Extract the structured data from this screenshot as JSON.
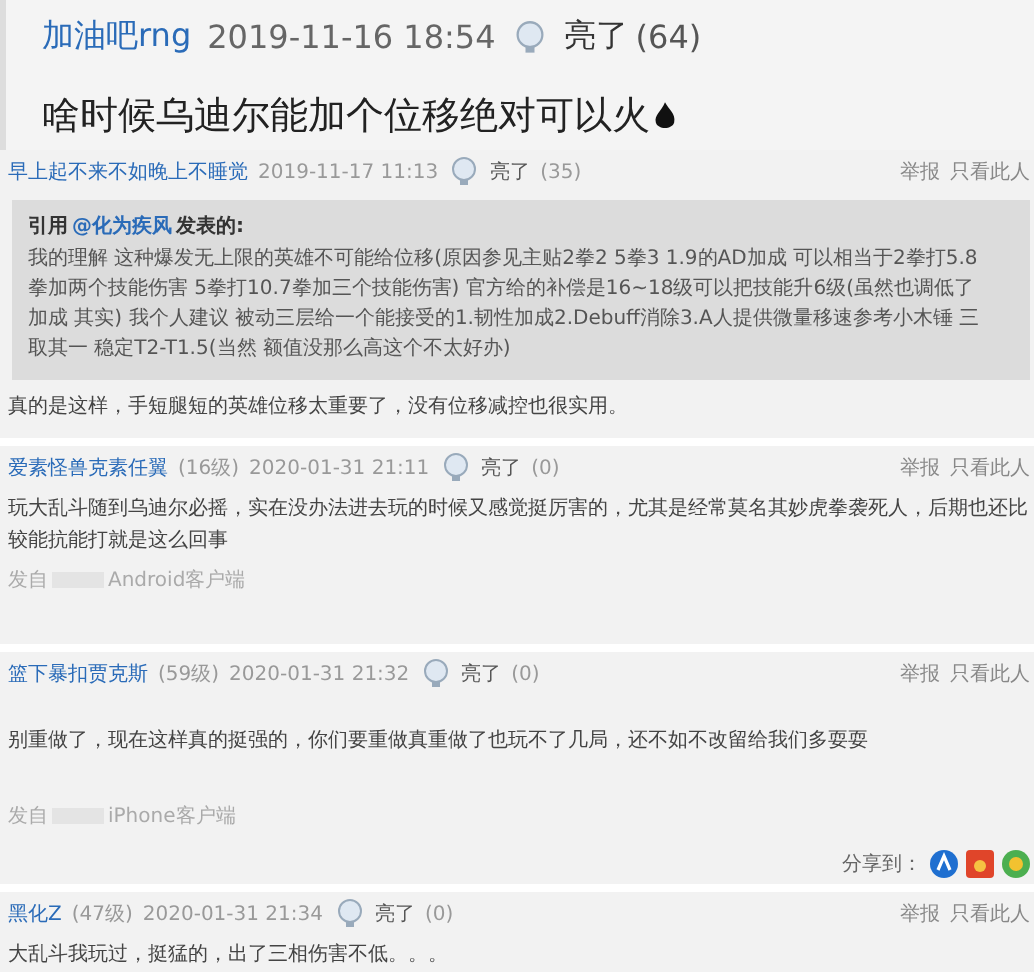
{
  "main_post": {
    "author": "加油吧rng",
    "time": "2019-11-16 18:54",
    "like": "亮了",
    "count": "(64)",
    "text": "啥时候乌迪尔能加个位移绝对可以火"
  },
  "replies": [
    {
      "author": "早上起不来不如晚上不睡觉",
      "time": "2019-11-17 11:13",
      "like": "亮了",
      "count": "(35)",
      "actions": [
        "举报",
        "只看此人"
      ],
      "quote": {
        "prefix": "引用",
        "user": "@化为疾风",
        "suffix": "发表的:",
        "text": "我的理解 这种爆发无上限的英雄不可能给位移(原因参见主贴2拳2 5拳3 1.9的AD加成 可以相当于2拳打5.8拳加两个技能伤害 5拳打10.7拳加三个技能伤害) 官方给的补偿是16~18级可以把技能升6级(虽然也调低了加成 其实) 我个人建议 被动三层给一个能接受的1.韧性加成2.Debuff消除3.A人提供微量移速参考小木锤 三取其一 稳定T2-T1.5(当然 额值没那么高这个不太好办)"
      },
      "text": "真的是这样，手短腿短的英雄位移太重要了，没有位移减控也很实用。"
    },
    {
      "author": "爱素怪兽克素任翼",
      "level": "(16级)",
      "time": "2020-01-31 21:11",
      "like": "亮了",
      "count": "(0)",
      "actions": [
        "举报",
        "只看此人"
      ],
      "text": "玩大乱斗随到乌迪尔必摇，实在没办法进去玩的时候又感觉挺厉害的，尤其是经常莫名其妙虎拳袭死人，后期也还比较能抗能打就是这么回事",
      "source": [
        "发自",
        "Android客户端"
      ]
    },
    {
      "author": "篮下暴扣贾克斯",
      "level": "(59级)",
      "time": "2020-01-31 21:32",
      "like": "亮了",
      "count": "(0)",
      "actions": [
        "举报",
        "只看此人"
      ],
      "text": "别重做了，现在这样真的挺强的，你们要重做真重做了也玩不了几局，还不如不改留给我们多耍耍",
      "source": [
        "发自",
        "iPhone客户端"
      ],
      "share": "分享到："
    },
    {
      "author": "黑化Z",
      "level": "(47级)",
      "time": "2020-01-31 21:34",
      "like": "亮了",
      "count": "(0)",
      "actions": [
        "举报",
        "只看此人"
      ],
      "text": "大乱斗我玩过，挺猛的，出了三相伤害不低。。。"
    }
  ]
}
